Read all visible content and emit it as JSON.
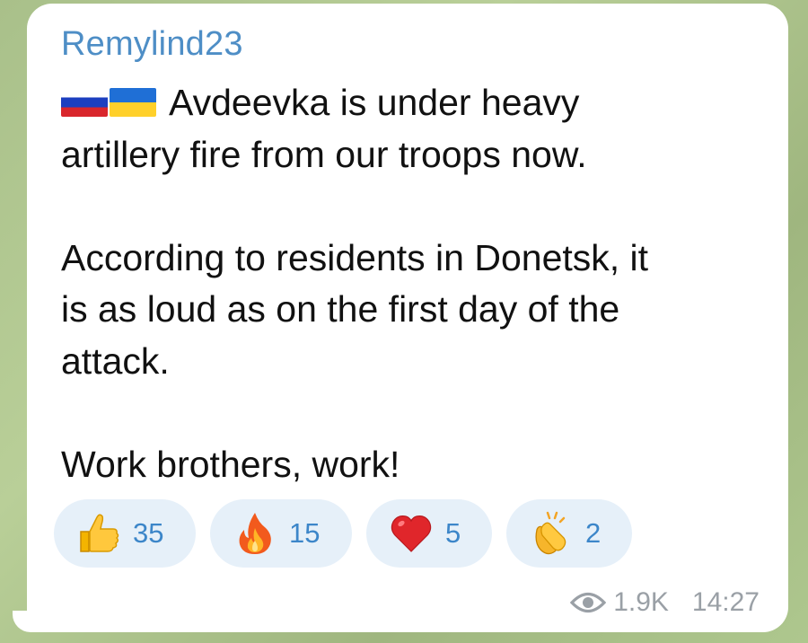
{
  "message": {
    "sender": "Remylind23",
    "lines": [
      "Avdeevka is under heavy",
      "artillery fire from our troops now.",
      "",
      "According to residents in Donetsk, it",
      "is as loud as on the first day of the",
      "attack.",
      "",
      "Work brothers, work!"
    ],
    "flags": [
      "russia-flag",
      "ukraine-flag"
    ]
  },
  "reactions": [
    {
      "icon": "thumbs-up-icon",
      "count": "35"
    },
    {
      "icon": "fire-icon",
      "count": "15"
    },
    {
      "icon": "heart-icon",
      "count": "5"
    },
    {
      "icon": "clapping-hands-icon",
      "count": "2"
    }
  ],
  "meta": {
    "views": "1.9K",
    "time": "14:27"
  },
  "colors": {
    "sender": "#4e8ec6",
    "reaction_bg": "#e6f0f9",
    "reaction_count": "#3c86c9",
    "meta": "#9aa0a6",
    "background": "#a9c08a"
  }
}
